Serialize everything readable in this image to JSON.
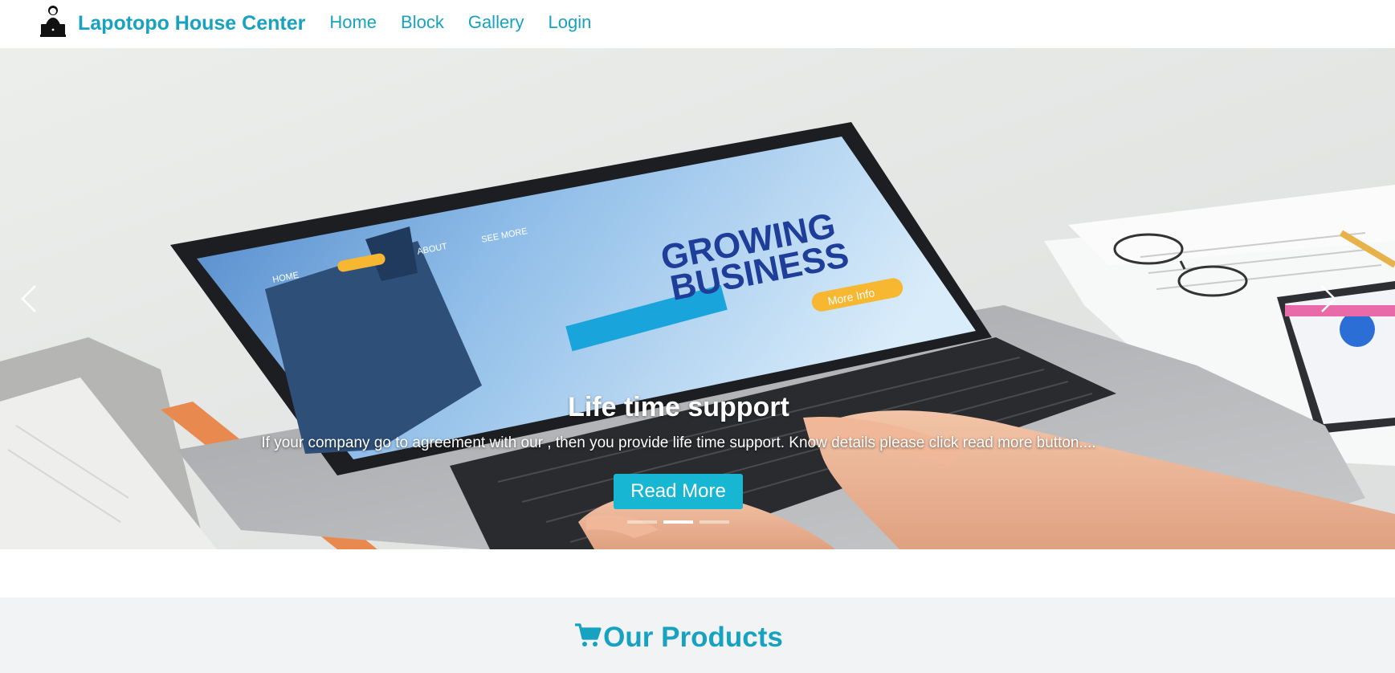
{
  "navbar": {
    "brand": "Lapotopo House Center",
    "brand_icon": "laptop-user-icon",
    "links": [
      "Home",
      "Block",
      "Gallery",
      "Login"
    ]
  },
  "carousel": {
    "slide_title": "Life time support",
    "slide_text": "If your company go to agreement with our , then you provide life time support. Know details please click read more button....",
    "button_label": "Read More",
    "indicator_count": 3,
    "active_indicator": 2,
    "prev_icon": "chevron-left-icon",
    "next_icon": "chevron-right-icon",
    "screen_heading": "GROWING BUSINESS",
    "screen_button": "More Info",
    "screen_nav": [
      "HOME",
      "ABOUT",
      "SEE MORE"
    ]
  },
  "products": {
    "heading": "Our Products",
    "icon": "shopping-cart-icon"
  },
  "colors": {
    "brand": "#17a2c2",
    "button": "#17b6d3",
    "section_bg": "#f1f3f5"
  }
}
